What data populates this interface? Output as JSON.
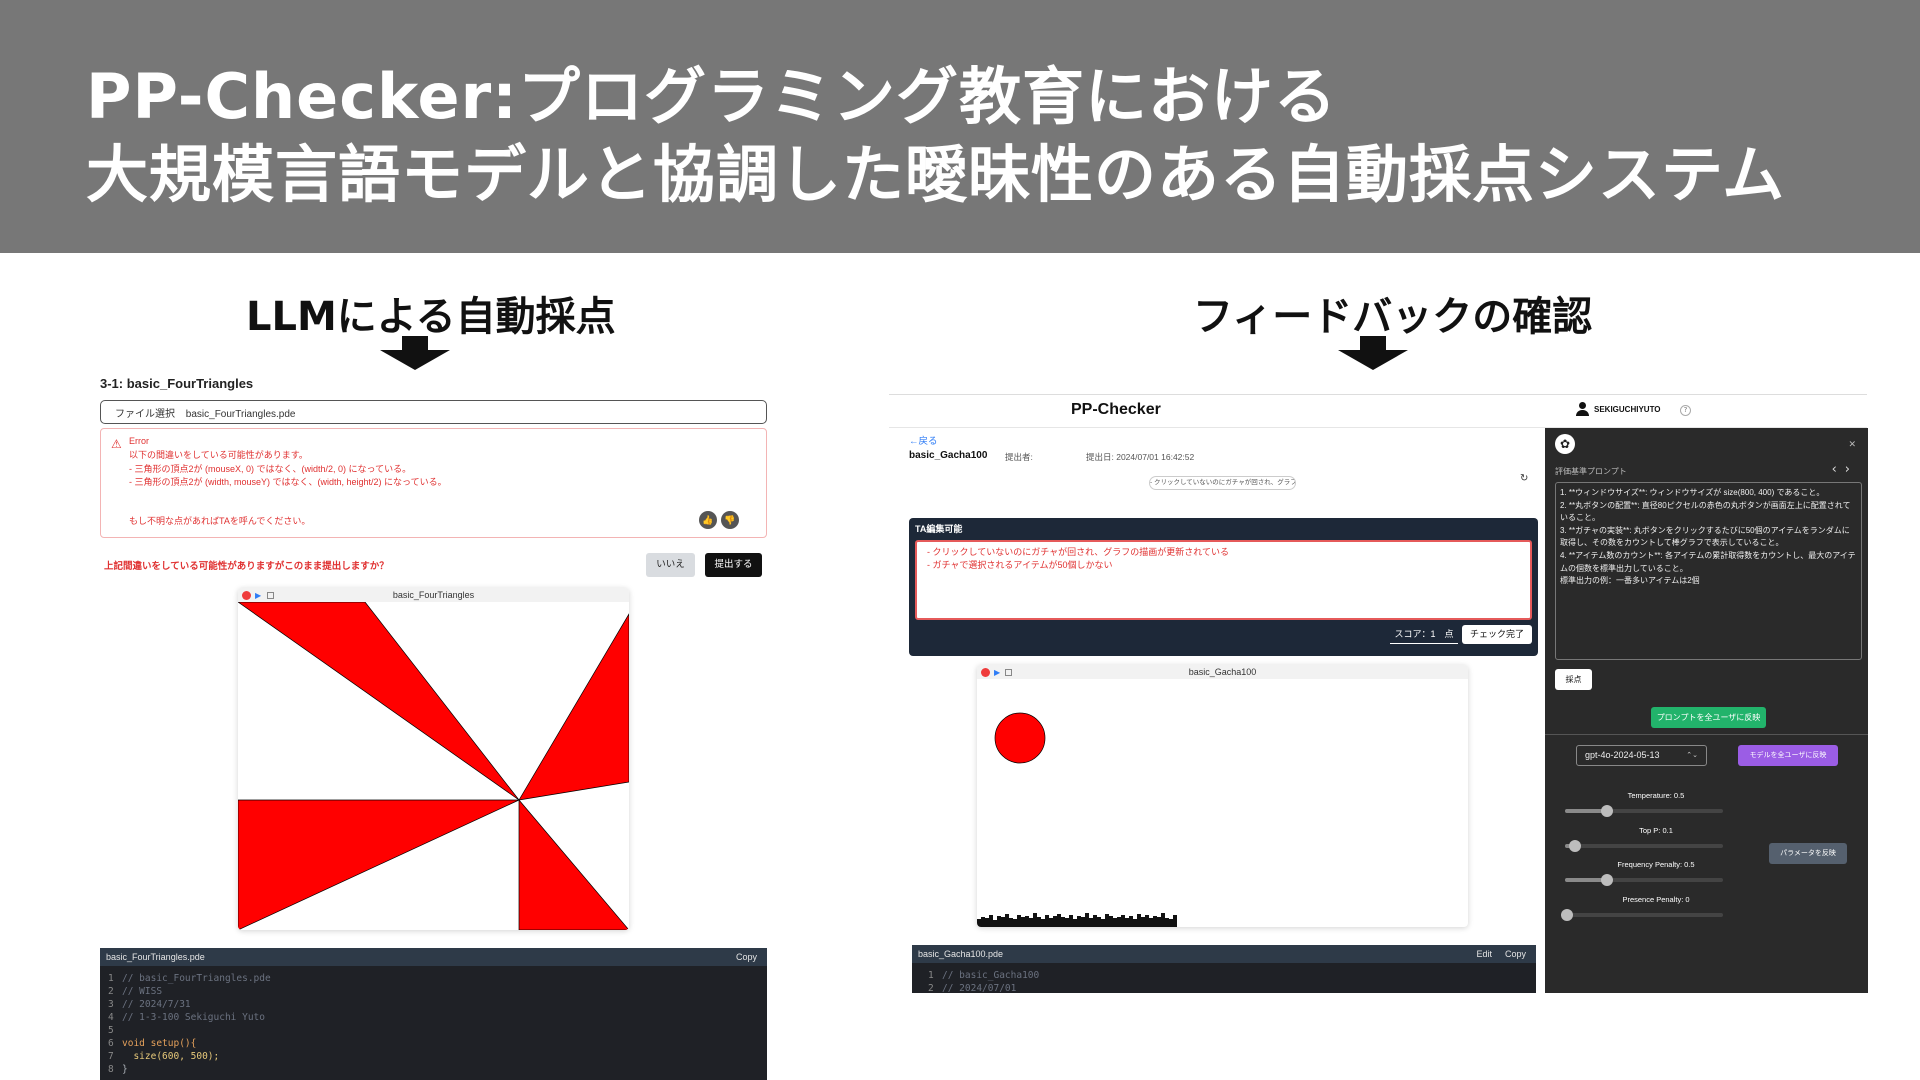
{
  "banner": {
    "line1": "PP-Checker:プログラミング教育における",
    "line2": "大規模言語モデルと協調した曖昧性のある自動採点システム"
  },
  "sections": {
    "left_title": "LLMによる自動採点",
    "right_title": "フィードバックの確認"
  },
  "left_panel": {
    "assignment_title": "3-1: basic_FourTriangles",
    "file_select_label": "ファイル選択",
    "file_name": "basic_FourTriangles.pde",
    "error": {
      "title": "Error",
      "lines": [
        "以下の間違いをしている可能性があります。",
        "- 三角形の頂点2が (mouseX, 0) ではなく、(width/2, 0) になっている。",
        "- 三角形の頂点2が (width, mouseY) ではなく、(width, height/2) になっている。"
      ],
      "footer": "もし不明な点があればTAを呼んでください。"
    },
    "confirm_question": "上記間違いをしている可能性がありますがこのまま提出しますか？",
    "no_button": "いいえ",
    "submit_button": "提出する",
    "sketch_title": "basic_FourTriangles",
    "code": {
      "filename": "basic_FourTriangles.pde",
      "copy_label": "Copy",
      "lines": [
        "// basic_FourTriangles.pde",
        "// WISS",
        "// 2024/7/31",
        "// 1-3-100 Sekiguchi Yuto",
        "",
        "void setup(){",
        "  size(600, 500);",
        "}"
      ]
    }
  },
  "right_panel": {
    "brand": "PP-Checker",
    "username": "SEKIGUCHIYUTO",
    "help": "?",
    "back_link": "←戻る",
    "assignment": "basic_Gacha100",
    "submitter_label": "提出者:",
    "submitted_at": "提出日: 2024/07/01 16:42:52",
    "feedback_pill": "- クリックしていないのにガチャが回され、グラフ...",
    "ta": {
      "title": "TA編集可能",
      "lines": [
        "- クリックしていないのにガチャが回され、グラフの描画が更新されている",
        "- ガチャで選択されるアイテムが50個しかない"
      ],
      "score": "スコア：1　点",
      "check_button": "チェック完了"
    },
    "sketch_title": "basic_Gacha100",
    "code": {
      "filename": "basic_Gacha100.pde",
      "edit_label": "Edit",
      "copy_label": "Copy",
      "lines": [
        "// basic_Gacha100",
        "// 2024/07/01"
      ]
    },
    "settings": {
      "prompt_label": "評価基準プロンプト",
      "prompt_lines": [
        "1. **ウィンドウサイズ**: ウィンドウサイズが size(800, 400) であること。",
        "2. **丸ボタンの配置**: 直径80ピクセルの赤色の丸ボタンが画面左上に配置されていること。",
        "3. **ガチャの実装**: 丸ボタンをクリックするたびに50個のアイテムをランダムに取得し、その数をカウントして棒グラフで表示していること。",
        "4. **アイテム数のカウント**: 各アイテムの累計取得数をカウントし、最大のアイテムの個数を標準出力していること。",
        "標準出力の例：一番多いアイテムは2個"
      ],
      "grade_button": "採点",
      "apply_prompt_button": "プロンプトを全ユーザに反映",
      "model": "gpt-4o-2024-05-13",
      "apply_model_button": "モデルを全ユーザに反映",
      "apply_params_button": "パラメータを反映",
      "params": [
        {
          "label": "Temperature: 0.5",
          "value": 0.5
        },
        {
          "label": "Top P: 0.1",
          "value": 0.1
        },
        {
          "label": "Frequency Penalty: 0.5",
          "value": 0.5
        },
        {
          "label": "Presence Penalty: 0",
          "value": 0
        }
      ]
    }
  },
  "colors": {
    "banner": "#777777",
    "error_red": "#e03131",
    "shape_red": "#ff0000",
    "dark_panel": "#1d2838",
    "settings_bg": "#2a2a2a",
    "green": "#22b36b",
    "purple": "#9b5de5"
  }
}
